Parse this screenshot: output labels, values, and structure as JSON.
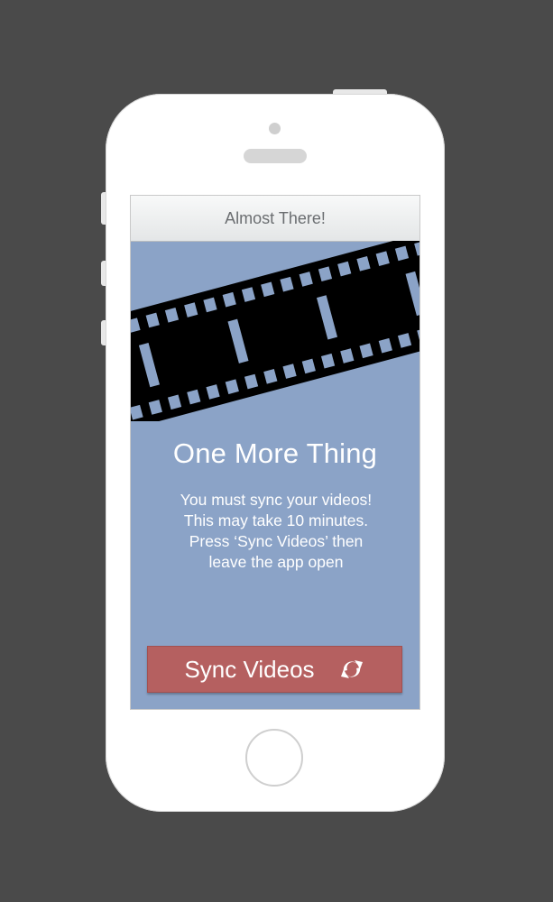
{
  "navbar": {
    "title": "Almost There!"
  },
  "content": {
    "heading": "One More Thing",
    "message_lines": [
      "You must sync your videos!",
      "This may take 10 minutes.",
      "Press ‘Sync Videos’ then",
      "leave the app open"
    ]
  },
  "sync_button": {
    "label": "Sync Videos",
    "icon": "sync-icon"
  },
  "colors": {
    "background": "#4a4a4a",
    "screen": "#8ba3c7",
    "button": "#b56060",
    "film": "#000000"
  }
}
